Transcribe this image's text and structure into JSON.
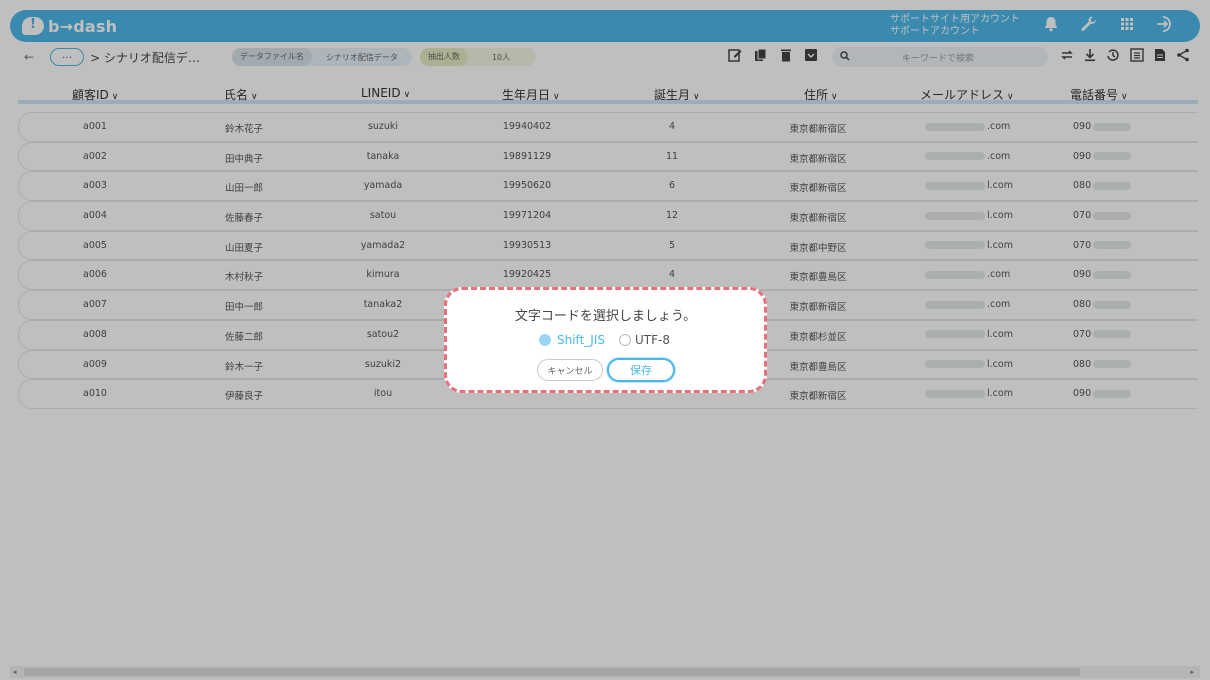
{
  "app": {
    "logo_text": "b→dash",
    "account_line1": "サポートサイト用アカウント",
    "account_line2": "サポートアカウント"
  },
  "toolbar": {
    "back": "←",
    "more": "···",
    "breadcrumb": "> シナリオ配信デ…",
    "datafile_tag": "データファイル名",
    "datafile_value": "シナリオ配信データ",
    "count_tag": "抽出人数",
    "count_value": "10人",
    "search_placeholder": "キーワードで検索"
  },
  "table": {
    "columns": [
      "顧客ID",
      "氏名",
      "LINEID",
      "生年月日",
      "誕生月",
      "住所",
      "メールアドレス",
      "電話番号"
    ],
    "rows": [
      {
        "id": "a001",
        "name": "鈴木花子",
        "lineid": "suzuki",
        "birth": "19940402",
        "month": "4",
        "addr": "東京都新宿区",
        "mail_suffix": ".com",
        "tel_prefix": "090"
      },
      {
        "id": "a002",
        "name": "田中典子",
        "lineid": "tanaka",
        "birth": "19891129",
        "month": "11",
        "addr": "東京都新宿区",
        "mail_suffix": ".com",
        "tel_prefix": "090"
      },
      {
        "id": "a003",
        "name": "山田一郎",
        "lineid": "yamada",
        "birth": "19950620",
        "month": "6",
        "addr": "東京都新宿区",
        "mail_suffix": "l.com",
        "tel_prefix": "080"
      },
      {
        "id": "a004",
        "name": "佐藤春子",
        "lineid": "satou",
        "birth": "19971204",
        "month": "12",
        "addr": "東京都新宿区",
        "mail_suffix": "l.com",
        "tel_prefix": "070"
      },
      {
        "id": "a005",
        "name": "山田夏子",
        "lineid": "yamada2",
        "birth": "19930513",
        "month": "5",
        "addr": "東京都中野区",
        "mail_suffix": "l.com",
        "tel_prefix": "070"
      },
      {
        "id": "a006",
        "name": "木村秋子",
        "lineid": "kimura",
        "birth": "19920425",
        "month": "4",
        "addr": "東京都豊島区",
        "mail_suffix": ".com",
        "tel_prefix": "090"
      },
      {
        "id": "a007",
        "name": "田中一郎",
        "lineid": "tanaka2",
        "birth": "",
        "month": "",
        "addr": "東京都新宿区",
        "mail_suffix": ".com",
        "tel_prefix": "080"
      },
      {
        "id": "a008",
        "name": "佐藤二郎",
        "lineid": "satou2",
        "birth": "",
        "month": "",
        "addr": "東京都杉並区",
        "mail_suffix": "l.com",
        "tel_prefix": "070"
      },
      {
        "id": "a009",
        "name": "鈴木一子",
        "lineid": "suzuki2",
        "birth": "",
        "month": "",
        "addr": "東京都豊島区",
        "mail_suffix": "l.com",
        "tel_prefix": "080"
      },
      {
        "id": "a010",
        "name": "伊藤良子",
        "lineid": "itou",
        "birth": "",
        "month": "",
        "addr": "東京都新宿区",
        "mail_suffix": "l.com",
        "tel_prefix": "090"
      }
    ]
  },
  "dialog": {
    "title": "文字コードを選択しましょう。",
    "option1": "Shift_JIS",
    "option2": "UTF-8",
    "selected": "Shift_JIS",
    "cancel_label": "キャンセル",
    "save_label": "保存"
  },
  "colors": {
    "accent": "#4db8e8",
    "dialog_border": "#e8707a"
  }
}
